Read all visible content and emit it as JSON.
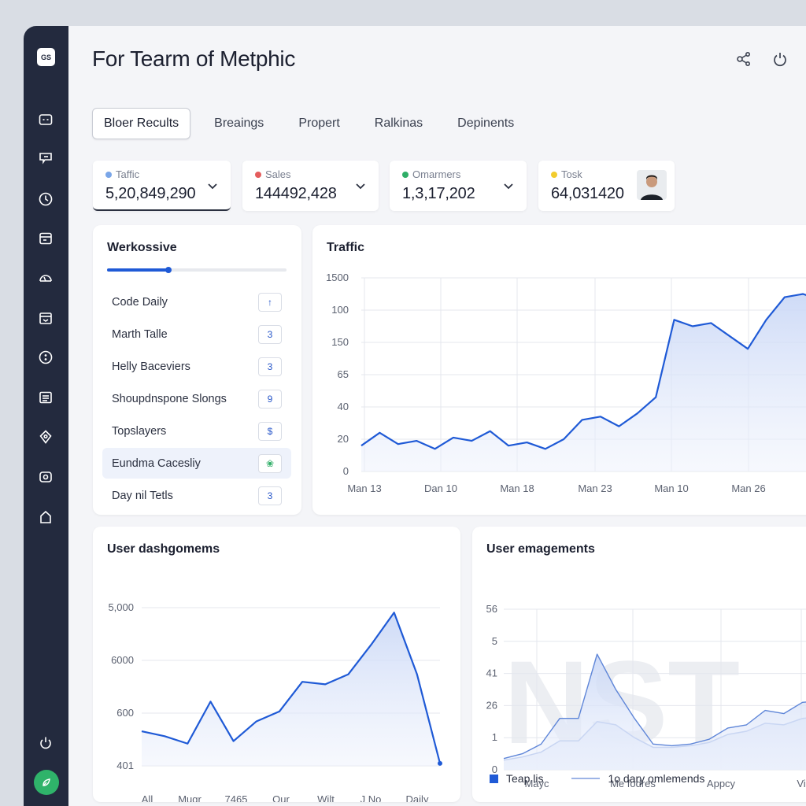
{
  "app": {
    "logo_text": "GS",
    "title": "For Tearm of Metphic"
  },
  "tabs": [
    "Bloer Recults",
    "Breaings",
    "Propert",
    "Ralkinas",
    "Depinents"
  ],
  "stats": [
    {
      "label": "Taffic",
      "value": "5,20,849,290",
      "color": "#7aa6e8"
    },
    {
      "label": "Sales",
      "value": "144492,428",
      "color": "#e45d5d"
    },
    {
      "label": "Omarmers",
      "value": "1,3,17,202",
      "color": "#2fae67"
    },
    {
      "label": "Tosk",
      "value": "64,031420",
      "color": "#f2cc2e"
    }
  ],
  "workouts": {
    "title": "Werkossive",
    "progress": 0.34,
    "items": [
      {
        "label": "Code Daily",
        "badge": "↑"
      },
      {
        "label": "Marth Talle",
        "badge": "3"
      },
      {
        "label": "Helly Baceviers",
        "badge": "3"
      },
      {
        "label": "Shoupdnspone Slongs",
        "badge": "9"
      },
      {
        "label": "Topslayers",
        "badge": "$"
      },
      {
        "label": "Eundma Cacesliy",
        "badge": "❀"
      },
      {
        "label": "Day nil Tetls",
        "badge": "3"
      }
    ]
  },
  "chart_data": [
    {
      "type": "area",
      "title": "Traffic",
      "y_ticks": [
        "1500",
        "100",
        "150",
        "65",
        "40",
        "20",
        "0"
      ],
      "x_ticks": [
        "Man 13",
        "Dan 10",
        "Man 18",
        "Man 23",
        "Man 10",
        "Man 26"
      ],
      "y_index_values": [
        0.8,
        1.2,
        0.85,
        0.95,
        0.7,
        1.05,
        0.95,
        1.25,
        0.8,
        0.9,
        0.7,
        1.0,
        1.6,
        1.7,
        1.4,
        1.8,
        2.3,
        4.7,
        4.5,
        4.6,
        4.2,
        3.8,
        4.7,
        5.4,
        5.5,
        5.3,
        5.4
      ],
      "grid": true
    },
    {
      "type": "area",
      "title": "User dashgomems",
      "y_ticks": [
        "5,000",
        "6000",
        "600",
        "401"
      ],
      "x_ticks": [
        "All",
        "Mugr",
        "7465",
        "Our",
        "Wilt",
        "J No",
        "Daily"
      ],
      "values": [
        0.7,
        0.6,
        0.45,
        1.3,
        0.5,
        0.9,
        1.1,
        1.7,
        1.65,
        1.85,
        2.45,
        3.1,
        1.85,
        0.05
      ],
      "grid": true
    },
    {
      "type": "area",
      "title": "User emagements",
      "y_ticks": [
        "56",
        "5",
        "41",
        "26",
        "1",
        "0"
      ],
      "x_ticks": [
        "Mayc",
        "Me fodres",
        "Appcy",
        "Vi"
      ],
      "series": [
        {
          "name": "Teap lis",
          "values": [
            0.35,
            0.5,
            0.8,
            1.6,
            1.6,
            3.6,
            2.5,
            1.6,
            0.8,
            0.75,
            0.8,
            0.95,
            1.3,
            1.4,
            1.85,
            1.75,
            2.1,
            2.15,
            2.25
          ]
        },
        {
          "name": "1o dary omlemends",
          "values": [
            0.3,
            0.4,
            0.55,
            0.9,
            0.9,
            1.5,
            1.4,
            1.0,
            0.7,
            0.7,
            0.75,
            0.85,
            1.1,
            1.2,
            1.45,
            1.4,
            1.6,
            1.65,
            1.75
          ]
        }
      ],
      "legend": "bottom-left"
    }
  ],
  "colors": {
    "accent": "#1f5ad6",
    "sidebar": "#232a3e",
    "area_fill": "#dbe5fa"
  }
}
